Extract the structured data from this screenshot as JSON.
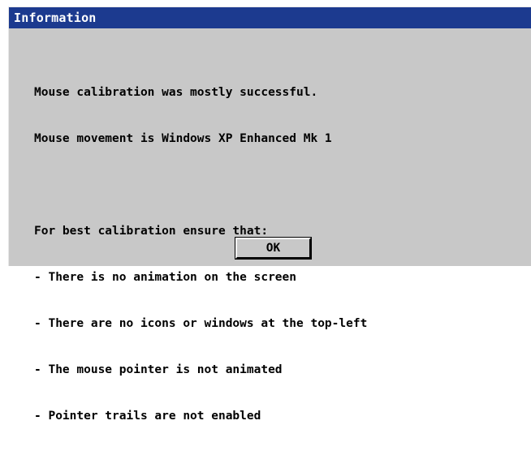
{
  "dialog": {
    "title": "Information",
    "summary_lines": [
      "Mouse calibration was mostly successful.",
      "Mouse movement is Windows XP Enhanced Mk 1"
    ],
    "tips_heading": "For best calibration ensure that:",
    "tips": [
      "- There is no animation on the screen",
      "- There are no icons or windows at the top-left",
      "- The mouse pointer is not animated",
      "- Pointer trails are not enabled"
    ],
    "ok_label": "OK"
  },
  "colors": {
    "titlebar": "#1c3a8f",
    "dialog_background": "#c8c8c8",
    "text": "#000000",
    "title_text": "#ffffff"
  }
}
